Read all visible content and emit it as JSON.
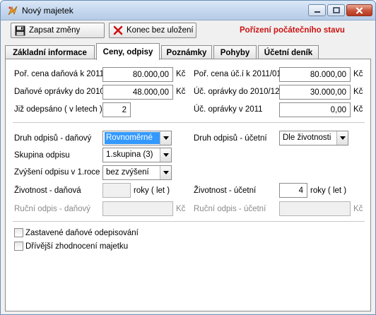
{
  "window": {
    "title": "Nový majetek"
  },
  "toolbar": {
    "save_label": "Zapsat změny",
    "cancel_label": "Konec bez uložení",
    "status_title": "Pořízení počátečního stavu"
  },
  "tabs": [
    {
      "label": "Základní informace"
    },
    {
      "label": "Ceny, odpisy"
    },
    {
      "label": "Poznámky"
    },
    {
      "label": "Pohyby"
    },
    {
      "label": "Účetní deník"
    }
  ],
  "prices": {
    "por_cena_danova": {
      "label": "Poř. cena daňová k 2011",
      "value": "80.000,00",
      "unit": "Kč"
    },
    "danove_opravky": {
      "label": "Daňové oprávky do 2010",
      "value": "48.000,00",
      "unit": "Kč"
    },
    "jiz_odepsano": {
      "label": "Již odepsáno ( v letech )",
      "value": "2"
    },
    "por_cena_ucetni": {
      "label": "Poř. cena úč.í k 2011/01",
      "value": "80.000,00",
      "unit": "Kč"
    },
    "uc_opravky_2010": {
      "label": "Úč. oprávky do 2010/12",
      "value": "30.000,00",
      "unit": "Kč"
    },
    "uc_opravky_2011": {
      "label": "Úč. oprávky v 2011",
      "value": "0,00",
      "unit": "Kč"
    }
  },
  "depreciation": {
    "druh_danovy": {
      "label": "Druh odpisů - daňový",
      "value": "Rovnoměrné"
    },
    "skupina": {
      "label": "Skupina odpisu",
      "value": "1.skupina (3)"
    },
    "zvyseni": {
      "label": "Zvýšení odpisu v 1.roce",
      "value": "bez zvýšení"
    },
    "druh_ucetni": {
      "label": "Druh odpisů - účetní",
      "value": "Dle životnosti"
    },
    "zivotnost_danova": {
      "label": "Životnost - daňová",
      "value": "",
      "unit": "roky ( let )"
    },
    "zivotnost_ucetni": {
      "label": "Životnost - účetní",
      "value": "4",
      "unit": "roky ( let )"
    },
    "rucni_danovy": {
      "label": "Ruční odpis - daňový",
      "value": "",
      "unit": "Kč"
    },
    "rucni_ucetni": {
      "label": "Ruční odpis - účetní",
      "value": "",
      "unit": "Kč"
    }
  },
  "options": {
    "zastavene": {
      "label": "Zastavené daňové odepisování",
      "checked": false
    },
    "drivejsi": {
      "label": "Dřívější zhodnocení majetku",
      "checked": false
    }
  }
}
